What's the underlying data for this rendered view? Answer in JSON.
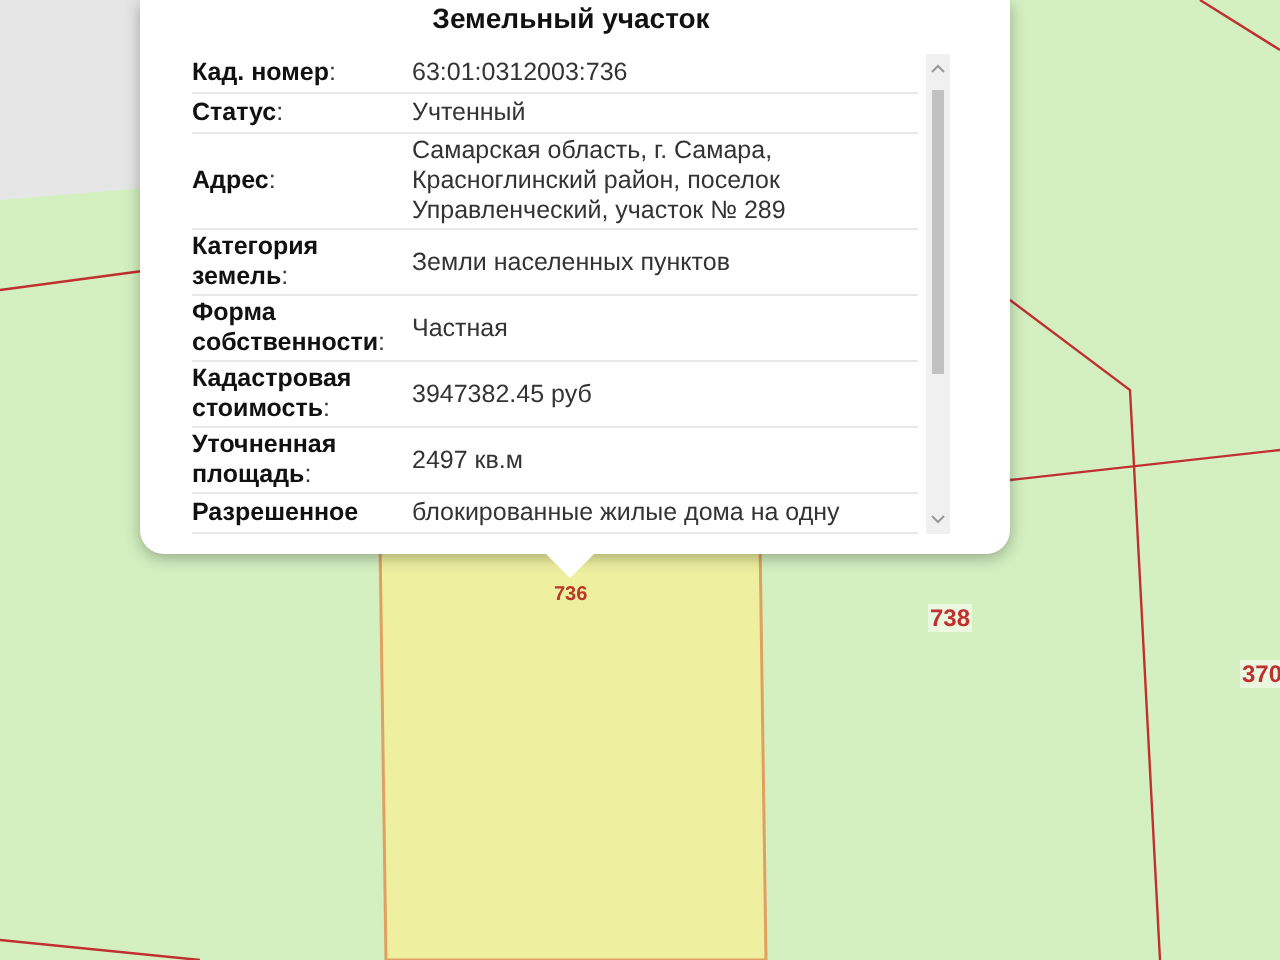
{
  "map": {
    "parcel_labels": [
      {
        "text": "736"
      },
      {
        "text": "738"
      },
      {
        "text": "370"
      }
    ]
  },
  "popup": {
    "title": "Земельный участок",
    "rows": [
      {
        "label": "**Кад. номер**:",
        "value": "63:01:0312003:736"
      },
      {
        "label": "**Статус**:",
        "value": "Учтенный"
      },
      {
        "label": "**Адрес**:",
        "value": "Самарская область, г. Самара, Красноглинский район, поселок Управленческий, участок № 289"
      },
      {
        "label": "**Категория земель**:",
        "value": "Земли населенных пунктов"
      },
      {
        "label": "**Форма собственности**:",
        "value": "Частная"
      },
      {
        "label": "**Кадастровая стоимость**:",
        "value": "3947382.45 руб"
      },
      {
        "label": "**Уточненная площадь**:",
        "value": "2497 кв.м"
      },
      {
        "label": "**Разрешенное**",
        "value": "блокированные жилые дома на одну"
      }
    ]
  }
}
